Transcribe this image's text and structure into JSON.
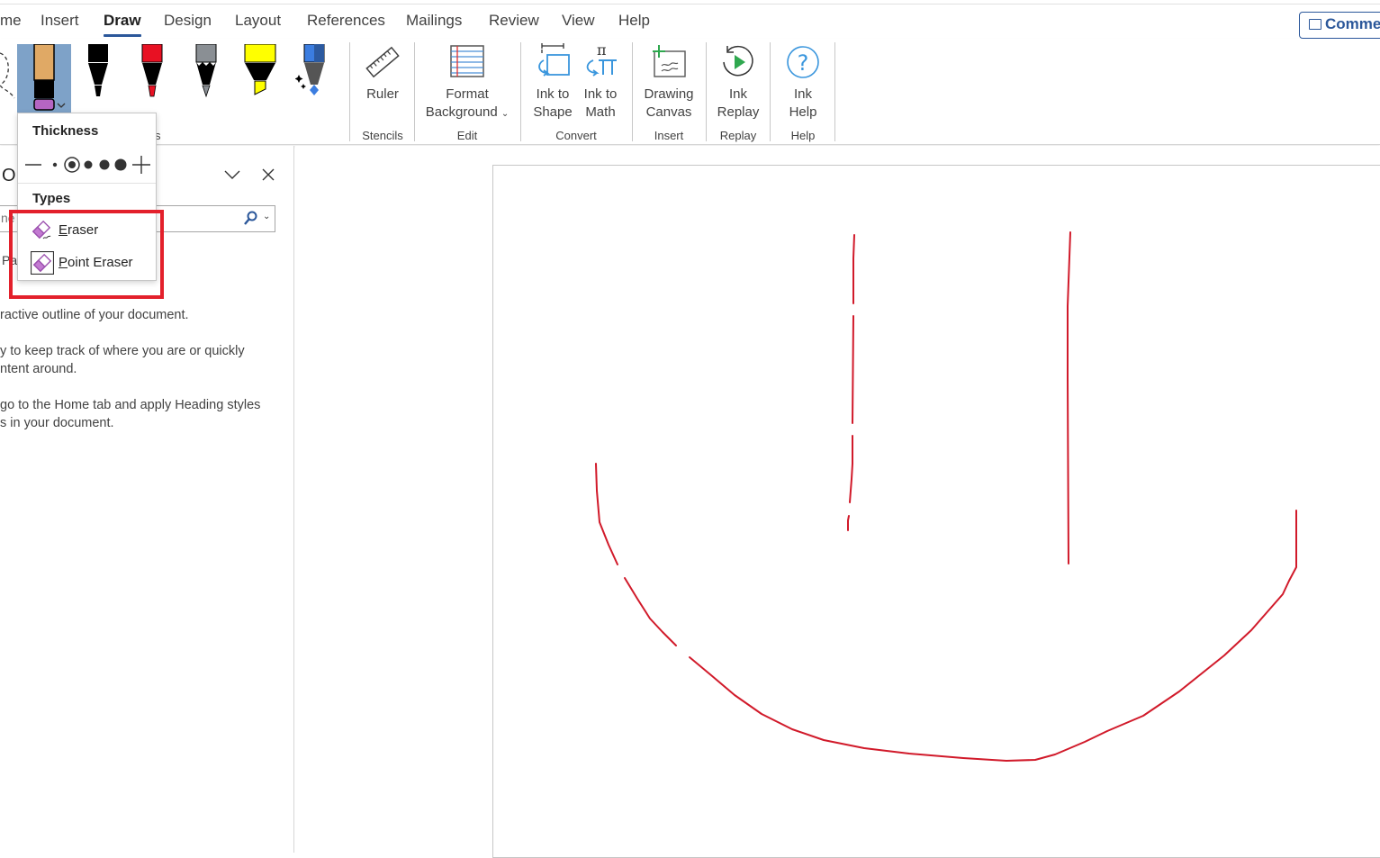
{
  "tabs": [
    {
      "label": "me",
      "active": false
    },
    {
      "label": "Insert",
      "active": false
    },
    {
      "label": "Draw",
      "active": true
    },
    {
      "label": "Design",
      "active": false
    },
    {
      "label": "Layout",
      "active": false
    },
    {
      "label": "References",
      "active": false
    },
    {
      "label": "Mailings",
      "active": false
    },
    {
      "label": "Review",
      "active": false
    },
    {
      "label": "View",
      "active": false
    },
    {
      "label": "Help",
      "active": false
    }
  ],
  "comments_button": {
    "label": "Comme",
    "icon": "comment-icon"
  },
  "pens": {
    "group_label_partial": "s",
    "items": [
      {
        "name": "eraser",
        "icon": "eraser-pen-icon",
        "selected": true
      },
      {
        "name": "black-pen",
        "icon": "pen-icon",
        "color": "#000000"
      },
      {
        "name": "red-pen",
        "icon": "pen-icon",
        "color": "#e81123"
      },
      {
        "name": "pencil",
        "icon": "pencil-icon",
        "color": "#7a7a7a"
      },
      {
        "name": "yellow-highlighter",
        "icon": "highlighter-icon",
        "color": "#ffff00"
      },
      {
        "name": "galaxy-pen",
        "icon": "galaxy-pen-icon",
        "color": "#3b7de0"
      }
    ]
  },
  "ribbon": {
    "groups": [
      {
        "label": "Stencils",
        "buttons": [
          {
            "label_lines": [
              "Ruler"
            ],
            "icon": "ruler-icon"
          }
        ]
      },
      {
        "label": "Edit",
        "buttons": [
          {
            "label_lines": [
              "Format",
              "Background"
            ],
            "icon": "format-background-icon",
            "dropdown": true
          }
        ]
      },
      {
        "label": "Convert",
        "buttons": [
          {
            "label_lines": [
              "Ink to",
              "Shape"
            ],
            "icon": "ink-to-shape-icon"
          },
          {
            "label_lines": [
              "Ink to",
              "Math"
            ],
            "icon": "ink-to-math-icon"
          }
        ]
      },
      {
        "label": "Insert",
        "buttons": [
          {
            "label_lines": [
              "Drawing",
              "Canvas"
            ],
            "icon": "drawing-canvas-icon"
          }
        ]
      },
      {
        "label": "Replay",
        "buttons": [
          {
            "label_lines": [
              "Ink",
              "Replay"
            ],
            "icon": "ink-replay-icon"
          }
        ]
      },
      {
        "label": "Help",
        "buttons": [
          {
            "label_lines": [
              "Ink",
              "Help"
            ],
            "icon": "ink-help-icon"
          }
        ]
      }
    ]
  },
  "eraser_popup": {
    "thickness_label": "Thickness",
    "thickness_options": [
      "decrease",
      "size-1",
      "size-2-selected",
      "size-3",
      "size-4",
      "size-5",
      "increase"
    ],
    "types_label": "Types",
    "types": [
      {
        "label": "Eraser",
        "accelerator": "E",
        "rest": "raser",
        "icon": "stroke-eraser-icon"
      },
      {
        "label": "Point Eraser",
        "accelerator": "P",
        "rest": "oint Eraser",
        "icon": "point-eraser-icon",
        "selected": true
      }
    ]
  },
  "nav_pane": {
    "title_partial": "O",
    "search_placeholder_partial": "ne",
    "tab_partial": "Pa",
    "paragraphs": [
      [
        "ractive outline of your document."
      ],
      [
        "y to keep track of where you are or quickly",
        "ntent around."
      ],
      [
        " go to the Home tab and apply Heading styles",
        "s in your document."
      ]
    ]
  },
  "colors": {
    "accent": "#2b579a",
    "ink": "#d11a2a",
    "highlight_box": "#e3202b",
    "selected_pen_bg": "#7ea2c8"
  }
}
